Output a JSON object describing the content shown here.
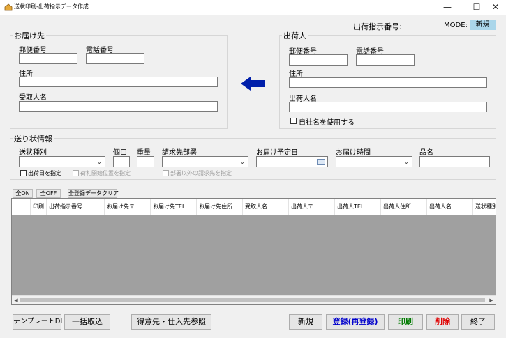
{
  "window": {
    "title": "送状印刷-出荷指示データ作成",
    "minimize_glyph": "—",
    "maximize_glyph": "☐",
    "close_glyph": "✕"
  },
  "header": {
    "shipping_no_label": "出荷指示番号:",
    "mode_label": "MODE:",
    "mode_value": "新規"
  },
  "recipient": {
    "group_title": "お届け先",
    "postal_label": "郵便番号",
    "postal_value": "",
    "phone_label": "電話番号",
    "phone_value": "",
    "address_label": "住所",
    "address_value": "",
    "name_label": "受取人名",
    "name_value": ""
  },
  "arrow": {
    "icon": "arrow-left",
    "color": "#001faa"
  },
  "shipper": {
    "group_title": "出荷人",
    "postal_label": "郵便番号",
    "postal_value": "",
    "phone_label": "電話番号",
    "phone_value": "",
    "address_label": "住所",
    "address_value": "",
    "name_label": "出荷人名",
    "name_value": "",
    "use_company_label": "自社名を使用する",
    "use_company_checked": false
  },
  "slip": {
    "group_title": "送り状情報",
    "type_label": "送状種別",
    "type_value": "",
    "count_label": "個口",
    "count_value": "",
    "weight_label": "重量",
    "weight_value": "",
    "dept_label": "請求先部署",
    "dept_value": "",
    "delivery_date_label": "お届け予定日",
    "delivery_date_value": "",
    "delivery_time_label": "お届け時間",
    "delivery_time_value": "",
    "item_label": "品名",
    "item_value": "",
    "ship_date_check_label": "出荷日を指定",
    "ship_date_checked": false,
    "tag_position_label": "荷札開始位置を指定",
    "other_dept_label": "部署以外の請求先を指定"
  },
  "grid_buttons": {
    "all_on": "全ON",
    "all_off": "全OFF",
    "clear_all": "全登録データクリア"
  },
  "grid": {
    "columns": [
      "印刷",
      "出荷指示番号",
      "お届け先〒",
      "お届け先TEL",
      "お届け先住所",
      "受取人名",
      "出荷人〒",
      "出荷人TEL",
      "出荷人住所",
      "出荷人名",
      "送状種別"
    ],
    "rows": []
  },
  "footer": {
    "template_dl": "テンプレートDL",
    "bulk_import": "一括取込",
    "customer_ref": "得意先・仕入先参照",
    "new": "新規",
    "register": "登録(再登録)",
    "print": "印刷",
    "delete": "削除",
    "exit": "終了"
  },
  "colors": {
    "register": "#0000cc",
    "print": "#007a00",
    "delete": "#e00000",
    "mode_bg": "#aad6ea"
  }
}
